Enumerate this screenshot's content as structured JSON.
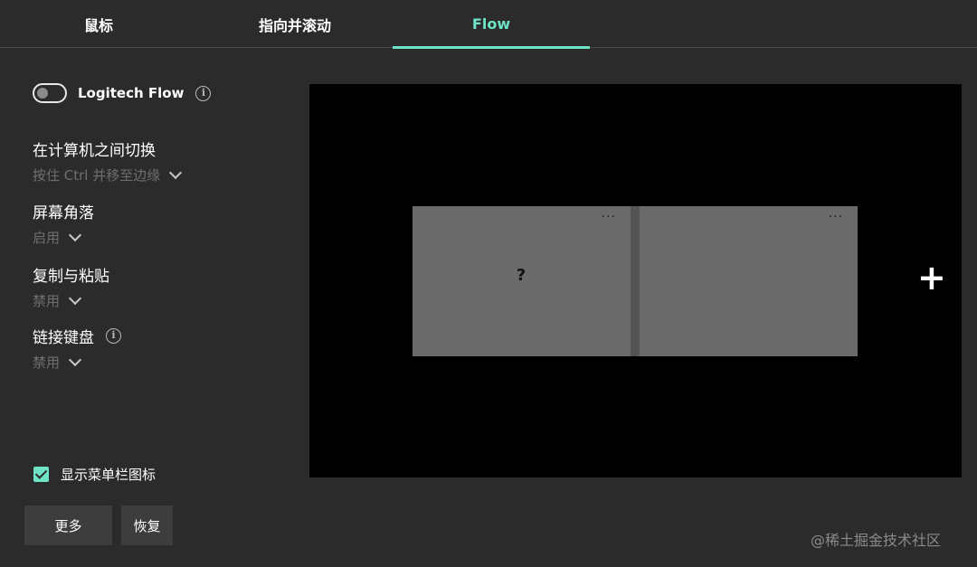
{
  "tabs": [
    {
      "label": "鼠标",
      "active": false
    },
    {
      "label": "指向并滚动",
      "active": false
    },
    {
      "label": "Flow",
      "active": true
    }
  ],
  "flow_toggle": {
    "label": "Logitech Flow",
    "enabled": false
  },
  "settings": {
    "switch": {
      "title": "在计算机之间切换",
      "value": "按住 Ctrl 并移至边缘"
    },
    "corners": {
      "title": "屏幕角落",
      "value": "启用"
    },
    "copy_paste": {
      "title": "复制与粘贴",
      "value": "禁用"
    },
    "link_keyboard": {
      "title": "链接键盘",
      "value": "禁用"
    }
  },
  "menubar_icon": {
    "label": "显示菜单栏图标",
    "checked": true
  },
  "buttons": {
    "more": "更多",
    "restore": "恢复"
  },
  "canvas": {
    "left_screen": {
      "symbol": "?",
      "menu": "···"
    },
    "right_screen": {
      "menu": "···"
    },
    "add": "+"
  },
  "watermark": "@稀土掘金技术社区",
  "colors": {
    "accent": "#6fe3c6",
    "background": "#2b2b2c",
    "canvas": "#000000",
    "screen": "#6a6a6a",
    "muted_text": "#6f6f70"
  },
  "icons": {
    "info": "info-icon",
    "dropdown": "chevron-down-icon",
    "menu": "more-horizontal-icon",
    "add": "plus-icon"
  }
}
